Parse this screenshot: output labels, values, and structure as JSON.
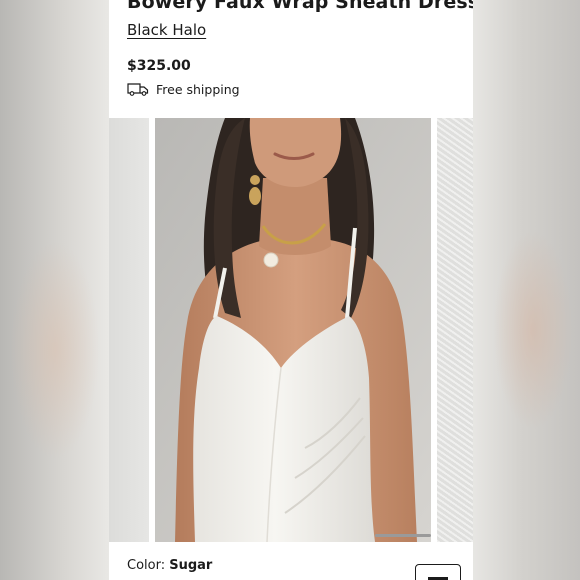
{
  "product": {
    "title": "Bowery Faux Wrap Sheath Dress",
    "brand": "Black Halo",
    "price": "$325.00",
    "shipping": {
      "label": "Free shipping",
      "icon": "truck-icon"
    },
    "color": {
      "label": "Color:",
      "value": "Sugar"
    }
  },
  "gallery": {
    "icons": [
      "dress-photo",
      "scroll-indicator"
    ]
  },
  "colors": {
    "text": "#1b1b1b",
    "panel": "#ffffff",
    "dress": "#f4f3ef",
    "backdrop": "#c9c7c3"
  }
}
